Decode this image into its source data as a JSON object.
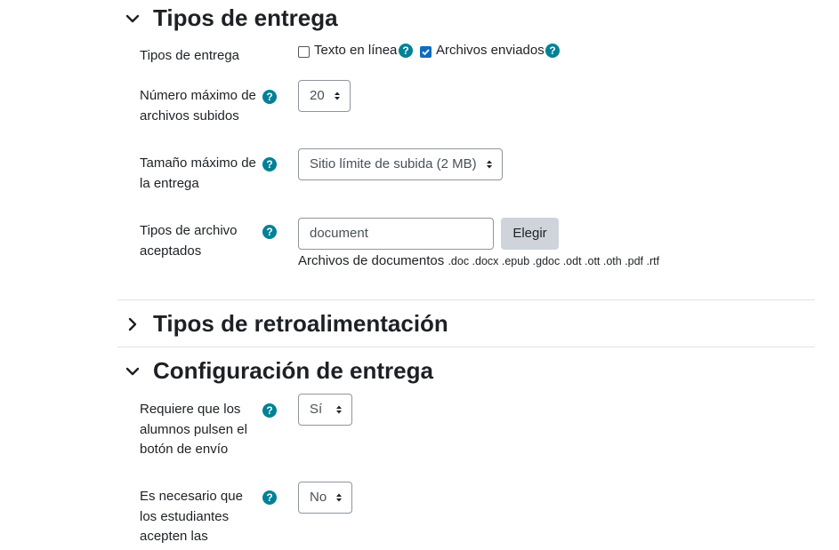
{
  "sections": {
    "submission_types": {
      "title": "Tipos de entrega",
      "expanded": true
    },
    "feedback_types": {
      "title": "Tipos de retroalimentación",
      "expanded": false
    },
    "submission_settings": {
      "title": "Configuración de entrega",
      "expanded": true
    }
  },
  "fields": {
    "submission_types": {
      "label": "Tipos de entrega",
      "options": [
        {
          "label": "Texto en línea",
          "checked": false
        },
        {
          "label": "Archivos enviados",
          "checked": true
        }
      ]
    },
    "max_files": {
      "label": "Número máximo de archivos subidos",
      "value": "20"
    },
    "max_size": {
      "label": "Tamaño máximo de la entrega",
      "value": "Sitio límite de subida (2 MB)"
    },
    "file_types": {
      "label": "Tipos de archivo aceptados",
      "value": "document",
      "button_label": "Elegir",
      "description": "Archivos de documentos",
      "extensions": ".doc .docx .epub .gdoc .odt .ott .oth .pdf .rtf"
    },
    "require_submit": {
      "label": "Requiere que los alumnos pulsen el botón de envío",
      "value": "Sí"
    },
    "require_accept": {
      "label": "Es necesario que los estudiantes acepten las",
      "value": "No"
    }
  },
  "help_icon_glyph": "?",
  "colors": {
    "help_icon": "#008196",
    "checkbox_checked": "#0f6cbf",
    "button_bg": "#ced4da",
    "border": "#8f959e"
  }
}
